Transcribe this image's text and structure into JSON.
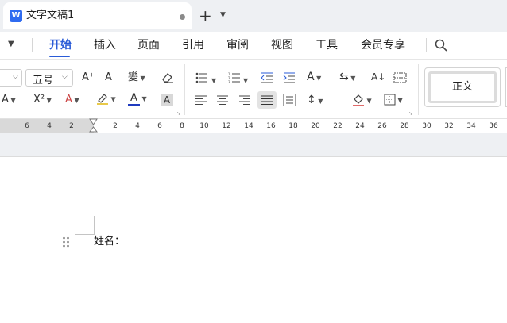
{
  "titlebar": {
    "app_logo": "W",
    "doc_title": "文字文稿1",
    "new_tab": "+"
  },
  "menubar": {
    "items": [
      "开始",
      "插入",
      "页面",
      "引用",
      "审阅",
      "视图",
      "工具",
      "会员专享"
    ],
    "active_index": 0,
    "accent": "#2a5bd7"
  },
  "ribbon": {
    "font_size": "五号",
    "grow_font": "A⁺",
    "shrink_font": "A⁻",
    "pinyin": "變",
    "superscript": "X²",
    "highlight_color": "#e8c94a",
    "font_color": "#1f3bbf",
    "shade_letter": "A",
    "style_normal": "正文"
  },
  "ruler": {
    "left_numbers": [
      "6",
      "4",
      "2"
    ],
    "right_numbers": [
      "2",
      "4",
      "6",
      "8",
      "10",
      "12",
      "14",
      "16",
      "18",
      "20",
      "22",
      "24",
      "26",
      "28",
      "30",
      "32",
      "34",
      "36"
    ]
  },
  "document": {
    "field_label": "姓名："
  }
}
